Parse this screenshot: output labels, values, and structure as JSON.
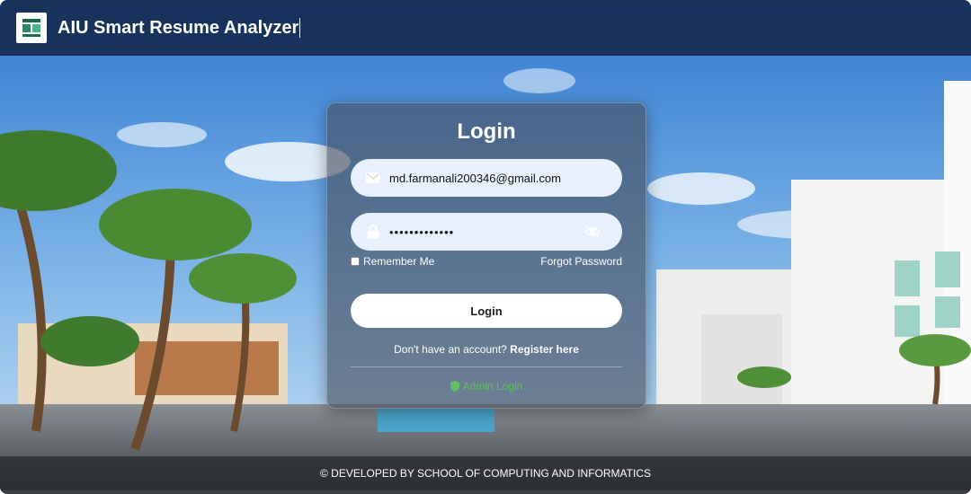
{
  "header": {
    "title": "AIU Smart Resume Analyzer",
    "logo": "aiu-logo-icon"
  },
  "login": {
    "title": "Login",
    "email_value": "md.farmanali200346@gmail.com",
    "email_icon": "envelope-icon",
    "password_value": "•••••••••••••",
    "password_icon": "lock-icon",
    "password_toggle_icon": "eye-slash-icon",
    "remember_label": "Remember Me",
    "forgot_label": "Forgot Password",
    "submit_label": "Login",
    "register_prompt": "Don't have an account?",
    "register_link": "Register here",
    "admin_icon": "shield-icon",
    "admin_label": "Admin Login"
  },
  "footer": {
    "text": "© DEVELOPED BY SCHOOL OF COMPUTING AND INFORMATICS"
  },
  "colors": {
    "header_bg": "#162d50",
    "field_bg": "#e8f0fe",
    "admin_green": "#5fc15f",
    "sky": "#4a90d9"
  }
}
